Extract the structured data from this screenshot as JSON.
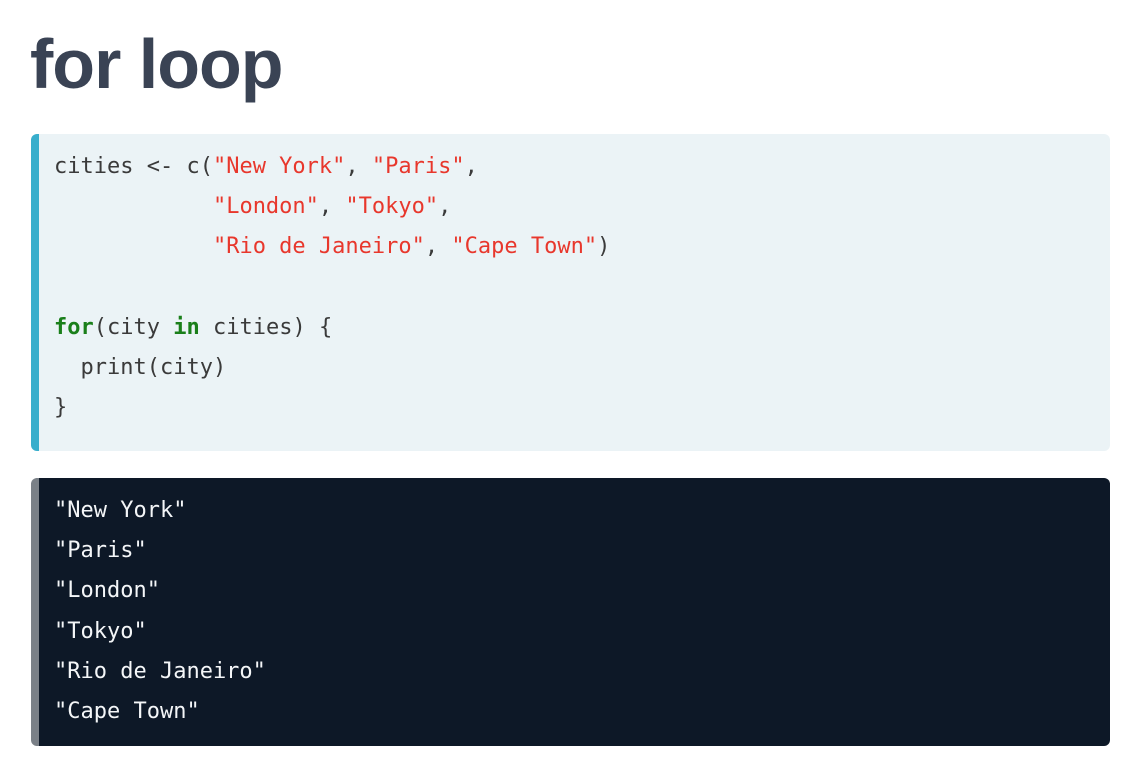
{
  "title": "for loop",
  "code": {
    "line1": {
      "p1": "cities <- c(",
      "s1": "\"New York\"",
      "p2": ", ",
      "s2": "\"Paris\"",
      "p3": ","
    },
    "line2": {
      "indent": "            ",
      "s1": "\"London\"",
      "p1": ", ",
      "s2": "\"Tokyo\"",
      "p2": ","
    },
    "line3": {
      "indent": "            ",
      "s1": "\"Rio de Janeiro\"",
      "p1": ", ",
      "s2": "\"Cape Town\"",
      "p2": ")"
    },
    "line5": {
      "kw1": "for",
      "p1": "(city ",
      "kw2": "in",
      "p2": " cities) {"
    },
    "line6": "  print(city)",
    "line7": "}"
  },
  "output": [
    "\"New York\"",
    "\"Paris\"",
    "\"London\"",
    "\"Tokyo\"",
    "\"Rio de Janeiro\"",
    "\"Cape Town\""
  ],
  "colors": {
    "string": "#e8372c",
    "keyword": "#1a7f1a",
    "code_accent": "#38aecc",
    "output_bg": "#0d1827"
  }
}
